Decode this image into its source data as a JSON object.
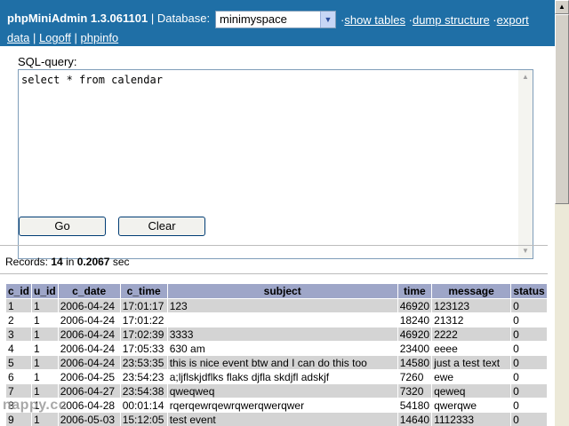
{
  "header": {
    "app_title": "phpMiniAdmin 1.3.061101",
    "db_label": "| Database:",
    "db_selected": "minimyspace",
    "links": [
      "show tables",
      "dump structure",
      "export",
      "data",
      "Logoff",
      "phpinfo"
    ]
  },
  "sql": {
    "label": "SQL-query:",
    "query": "select * from calendar",
    "go_label": "Go",
    "clear_label": "Clear"
  },
  "records": {
    "prefix": "Records:",
    "count": "14",
    "mid": "in",
    "time": "0.2067",
    "suffix": "sec"
  },
  "table": {
    "columns": [
      "c_id",
      "u_id",
      "c_date",
      "c_time",
      "subject",
      "time",
      "message",
      "status"
    ],
    "rows": [
      [
        "1",
        "1",
        "2006-04-24",
        "17:01:17",
        "123",
        "46920",
        "123123",
        "0"
      ],
      [
        "2",
        "1",
        "2006-04-24",
        "17:01:22",
        "",
        "18240",
        "21312",
        "0"
      ],
      [
        "3",
        "1",
        "2006-04-24",
        "17:02:39",
        "3333",
        "46920",
        "2222",
        "0"
      ],
      [
        "4",
        "1",
        "2006-04-24",
        "17:05:33",
        "630 am",
        "23400",
        "eeee",
        "0"
      ],
      [
        "5",
        "1",
        "2006-04-24",
        "23:53:35",
        "this is nice event btw and I can do this too",
        "14580",
        "just a test text",
        "0"
      ],
      [
        "6",
        "1",
        "2006-04-25",
        "23:54:23",
        "a;ljflskjdflks flaks djfla skdjfl adskjf",
        "7260",
        "ewe",
        "0"
      ],
      [
        "7",
        "1",
        "2006-04-27",
        "23:54:38",
        "qweqweq",
        "7320",
        "qeweq",
        "0"
      ],
      [
        "8",
        "1",
        "2006-04-28",
        "00:01:14",
        "rqerqewrqewrqwerqwerqwer",
        "54180",
        "qwerqwe",
        "0"
      ],
      [
        "9",
        "1",
        "2006-05-03",
        "15:12:05",
        "test event",
        "14640",
        "1112333",
        "0"
      ]
    ]
  },
  "watermark": "nappy.cc",
  "colors": {
    "header_bg": "#1f6fa6",
    "th_bg": "#9ea6c8",
    "row_odd": "#d4d4d4"
  }
}
